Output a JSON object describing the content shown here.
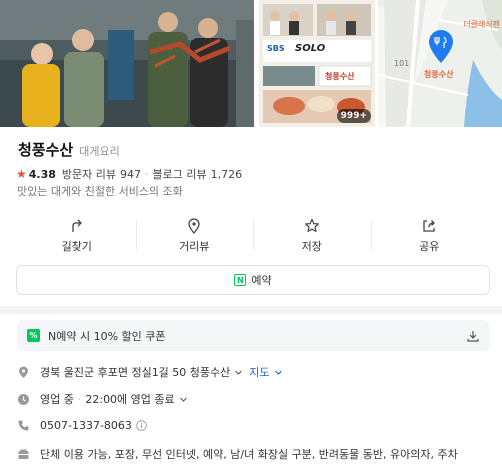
{
  "gallery": {
    "main_alt": "store-photo",
    "mid_alt": "tv-feature-photo",
    "map_alt": "location-map",
    "more_count": "999+",
    "tv_logo": "SBS",
    "tv_show": "SOLO",
    "tv_store_sign": "청풍수산",
    "map_pin_label": "청풍수산",
    "map_poi_label": "더클래식펜",
    "map_road_number": "101"
  },
  "place": {
    "name": "청풍수산",
    "category": "대게요리",
    "rating": "4.38",
    "visitor_reviews_label": "방문자 리뷰",
    "visitor_reviews_count": "947",
    "blog_reviews_label": "블로그 리뷰",
    "blog_reviews_count": "1,726",
    "description": "맛있는 대게와 친절한 서비스의 조화"
  },
  "actions": [
    {
      "label": "길찾기",
      "icon": "directions-icon"
    },
    {
      "label": "거리뷰",
      "icon": "street-view-icon"
    },
    {
      "label": "저장",
      "icon": "star-icon"
    },
    {
      "label": "공유",
      "icon": "share-icon"
    }
  ],
  "reserve": {
    "badge": "N",
    "label": "예약"
  },
  "coupon": {
    "badge": "%",
    "text": "N예약 시 10% 할인 쿠폰"
  },
  "info": {
    "address": "경북 울진군 후포면 정실1길 50 청풍수산",
    "map_link": "지도",
    "hours_status": "영업 중",
    "hours_detail": "22:00에 영업 종료",
    "phone": "0507-1337-8063",
    "amenities": "단체 이용 가능, 포장, 무선 인터넷, 예약, 남/녀 화장실 구분, 반려동물 동반, 유아의자, 주차"
  },
  "colors": {
    "accent_green": "#03c75a",
    "star_red": "#f04d3d",
    "link_blue": "#1a63d9"
  }
}
